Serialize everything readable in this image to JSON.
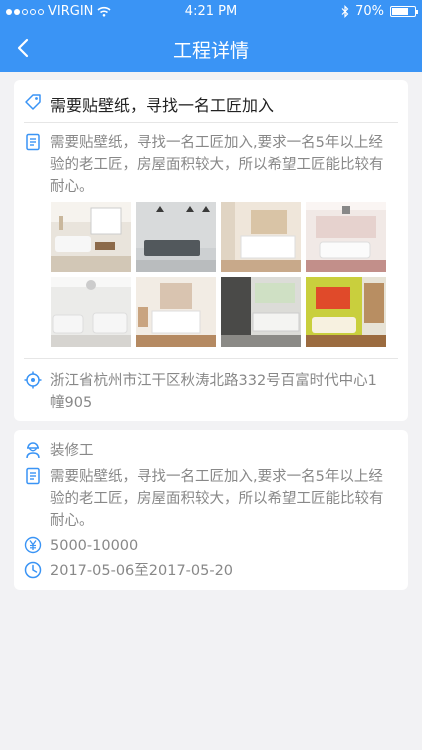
{
  "status": {
    "carrier": "VIRGIN",
    "time": "4:21 PM",
    "battery": "70%"
  },
  "nav": {
    "title": "工程详情"
  },
  "project": {
    "title": "需要贴壁纸，寻找一名工匠加入",
    "description_lines": [
      "需要贴壁纸，寻找一名工匠加入,要求一名5年以上经",
      "验的老工匠，房屋面积较大，所以希望工匠能比较有",
      "耐心。"
    ],
    "address_lines": [
      "浙江省杭州市江干区秋涛北路332号百富时代中心1",
      "幢905"
    ]
  },
  "job": {
    "worker_type": "装修工",
    "description_lines": [
      "需要贴壁纸，寻找一名工匠加入,要求一名5年以上经",
      "验的老工匠，房屋面积较大，所以希望工匠能比较有",
      "耐心。"
    ],
    "salary": "5000-10000",
    "date_range": "2017-05-06至2017-05-20"
  },
  "colors": {
    "primary": "#3a94f5",
    "text_dark": "#222222",
    "text_muted": "#888888",
    "background": "#f2f2f4"
  },
  "icons": {
    "back": "chevron-left-icon",
    "tag": "tag-icon",
    "document": "document-icon",
    "location": "location-target-icon",
    "worker": "worker-icon",
    "money": "yen-icon",
    "clock": "clock-icon"
  }
}
